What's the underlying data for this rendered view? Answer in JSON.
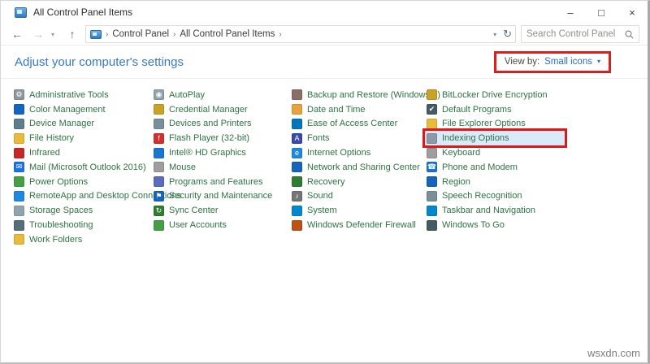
{
  "window": {
    "title": "All Control Panel Items",
    "controls": {
      "minimize": "–",
      "maximize": "□",
      "close": "×"
    }
  },
  "navbar": {
    "back": "←",
    "forward": "→",
    "dropdown_arrow": "▾",
    "up": "↑",
    "breadcrumb": {
      "crumb1": "Control Panel",
      "crumb2": "All Control Panel Items",
      "separator": "›"
    },
    "address_chevron": "▾",
    "refresh": "↻",
    "search": {
      "placeholder": "Search Control Panel"
    }
  },
  "header": {
    "title": "Adjust your computer's settings",
    "view_by_label": "View by:",
    "view_by_value": "Small icons",
    "view_by_arrow": "▾"
  },
  "colors": {
    "heading_blue": "#3779c2",
    "link_blue": "#2b6cc4",
    "item_text_green": "#2e7245",
    "annotation_red": "#e21b1b",
    "selection_bg": "#dbeaf9"
  },
  "items": {
    "columns": [
      [
        {
          "label": "Administrative Tools",
          "icon": "administrative-tools-icon",
          "color": "#8f979e",
          "glyph": "⚙"
        },
        {
          "label": "Color Management",
          "icon": "color-management-icon",
          "color": "#1565c0",
          "glyph": ""
        },
        {
          "label": "Device Manager",
          "icon": "device-manager-icon",
          "color": "#607d8b",
          "glyph": ""
        },
        {
          "label": "File History",
          "icon": "file-history-icon",
          "color": "#e8bb3a",
          "glyph": ""
        },
        {
          "label": "Infrared",
          "icon": "infrared-icon",
          "color": "#c62828",
          "glyph": ""
        },
        {
          "label": "Mail (Microsoft Outlook 2016)",
          "icon": "mail-icon",
          "color": "#1a73e8",
          "glyph": "✉"
        },
        {
          "label": "Power Options",
          "icon": "power-options-icon",
          "color": "#43a047",
          "glyph": ""
        },
        {
          "label": "RemoteApp and Desktop Connections",
          "icon": "remoteapp-icon",
          "color": "#1e88e5",
          "glyph": ""
        },
        {
          "label": "Storage Spaces",
          "icon": "storage-spaces-icon",
          "color": "#90a4ae",
          "glyph": ""
        },
        {
          "label": "Troubleshooting",
          "icon": "troubleshooting-icon",
          "color": "#546e7a",
          "glyph": ""
        },
        {
          "label": "Work Folders",
          "icon": "work-folders-icon",
          "color": "#e8bb3a",
          "glyph": ""
        }
      ],
      [
        {
          "label": "AutoPlay",
          "icon": "autoplay-icon",
          "color": "#8fa3ad",
          "glyph": "◉"
        },
        {
          "label": "Credential Manager",
          "icon": "credential-manager-icon",
          "color": "#c9a227",
          "glyph": ""
        },
        {
          "label": "Devices and Printers",
          "icon": "devices-and-printers-icon",
          "color": "#78909c",
          "glyph": ""
        },
        {
          "label": "Flash Player (32-bit)",
          "icon": "flash-player-icon",
          "color": "#d32f2f",
          "glyph": "f"
        },
        {
          "label": "Intel® HD Graphics",
          "icon": "intel-graphics-icon",
          "color": "#1976d2",
          "glyph": ""
        },
        {
          "label": "Mouse",
          "icon": "mouse-icon",
          "color": "#9e9e9e",
          "glyph": ""
        },
        {
          "label": "Programs and Features",
          "icon": "programs-and-features-icon",
          "color": "#5c6bc0",
          "glyph": ""
        },
        {
          "label": "Security and Maintenance",
          "icon": "security-maintenance-icon",
          "color": "#1565c0",
          "glyph": "⚑"
        },
        {
          "label": "Sync Center",
          "icon": "sync-center-icon",
          "color": "#2e7d32",
          "glyph": "↻"
        },
        {
          "label": "User Accounts",
          "icon": "user-accounts-icon",
          "color": "#43a047",
          "glyph": ""
        }
      ],
      [
        {
          "label": "Backup and Restore (Windows 7)",
          "icon": "backup-restore-icon",
          "color": "#8d6e63",
          "glyph": ""
        },
        {
          "label": "Date and Time",
          "icon": "date-and-time-icon",
          "color": "#e8a33d",
          "glyph": ""
        },
        {
          "label": "Ease of Access Center",
          "icon": "ease-of-access-icon",
          "color": "#0277bd",
          "glyph": ""
        },
        {
          "label": "Fonts",
          "icon": "fonts-icon",
          "color": "#3949ab",
          "glyph": "A"
        },
        {
          "label": "Internet Options",
          "icon": "internet-options-icon",
          "color": "#1e88e5",
          "glyph": "e"
        },
        {
          "label": "Network and Sharing Center",
          "icon": "network-sharing-icon",
          "color": "#1565c0",
          "glyph": ""
        },
        {
          "label": "Recovery",
          "icon": "recovery-icon",
          "color": "#2e7d32",
          "glyph": ""
        },
        {
          "label": "Sound",
          "icon": "sound-icon",
          "color": "#757575",
          "glyph": "♪"
        },
        {
          "label": "System",
          "icon": "system-icon",
          "color": "#0288d1",
          "glyph": ""
        },
        {
          "label": "Windows Defender Firewall",
          "icon": "windows-firewall-icon",
          "color": "#bf5117",
          "glyph": ""
        }
      ],
      [
        {
          "label": "BitLocker Drive Encryption",
          "icon": "bitlocker-icon",
          "color": "#c9a227",
          "glyph": ""
        },
        {
          "label": "Default Programs",
          "icon": "default-programs-icon",
          "color": "#455a64",
          "glyph": "✔"
        },
        {
          "label": "File Explorer Options",
          "icon": "file-explorer-options-icon",
          "color": "#e8bb3a",
          "glyph": ""
        },
        {
          "label": "Indexing Options",
          "icon": "indexing-options-icon",
          "color": "#8d99a6",
          "glyph": "",
          "selected": true
        },
        {
          "label": "Keyboard",
          "icon": "keyboard-icon",
          "color": "#9e9e9e",
          "glyph": ""
        },
        {
          "label": "Phone and Modem",
          "icon": "phone-and-modem-icon",
          "color": "#1976d2",
          "glyph": "☎"
        },
        {
          "label": "Region",
          "icon": "region-icon",
          "color": "#1565c0",
          "glyph": ""
        },
        {
          "label": "Speech Recognition",
          "icon": "speech-recognition-icon",
          "color": "#78909c",
          "glyph": ""
        },
        {
          "label": "Taskbar and Navigation",
          "icon": "taskbar-navigation-icon",
          "color": "#0288d1",
          "glyph": ""
        },
        {
          "label": "Windows To Go",
          "icon": "windows-to-go-icon",
          "color": "#455a64",
          "glyph": ""
        }
      ]
    ]
  },
  "watermark": "wsxdn.com"
}
